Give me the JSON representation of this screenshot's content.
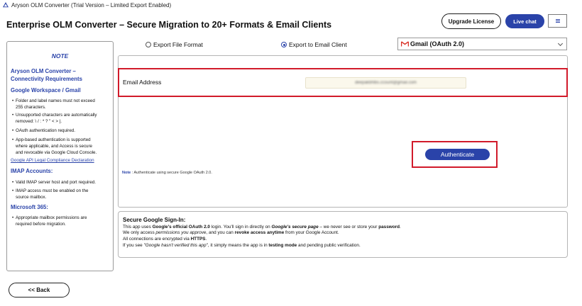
{
  "window": {
    "title": "Aryson OLM Converter (Trial Version – Limited Export Enabled)"
  },
  "header": {
    "title": "Enterprise OLM Converter – Secure Migration to 20+ Formats & Email Clients",
    "upgrade_label": "Upgrade License",
    "livechat_label": "Live chat",
    "menu_icon": "hamburger-icon"
  },
  "sidebar": {
    "note_heading": "NOTE",
    "title_line1": "Aryson OLM Converter –",
    "title_line2": "Connectivity Requirements",
    "google_heading": "Google Workspace / Gmail",
    "google_items": [
      [
        "Folder and label names must not exceed",
        "255 characters."
      ],
      [
        "Unsupported characters are automatically",
        "removed: \\ / : * ? \" < > |."
      ],
      [
        "OAuth authentication required."
      ],
      [
        "App-based authentication is supported",
        "where applicable, and Access is secure",
        "and revocable via Google Cloud Console."
      ]
    ],
    "google_link": "Google API Legal Compliance Declaration",
    "imap_heading": "IMAP Accounts:",
    "imap_items": [
      [
        "Valid IMAP server host and port required."
      ],
      [
        "IMAP access must be enabled on the",
        "source mailbox."
      ]
    ],
    "ms_heading": "Microsoft 365:",
    "ms_items": [
      [
        "Appropriate mailbox permissions are",
        "required before migration."
      ]
    ]
  },
  "export_options": {
    "file_format_label": "Export File Format",
    "email_client_label": "Export to Email Client",
    "selected": "Export to Email Client"
  },
  "client_select": {
    "value": "Gmail (OAuth 2.0)",
    "icon": "gmail-icon"
  },
  "form": {
    "email_label": "Email Address",
    "email_value": "deepakbhlbs.ccount@gmail.com",
    "authenticate_label": "Authenticate",
    "note_prefix": "Note",
    "note_text": " : Authenticate using secure Google OAuth 2.0."
  },
  "secure_info": {
    "title": "Secure Google Sign-In:",
    "lines": [
      "This app uses Google's official OAuth 2.0 login. You'll sign in directly on Google's secure page – we never see or store your password.",
      "We only access permissions you approve, and you can revoke access anytime from your Google Account.",
      "All connections are encrypted via HTTPS.",
      "If you see \"Google hasn't verified this app\", it simply means the app is in testing mode and pending public verification."
    ]
  },
  "footer": {
    "back_label": "<< Back"
  },
  "colors": {
    "accent": "#2a43a9",
    "highlight": "#d11a2a"
  }
}
